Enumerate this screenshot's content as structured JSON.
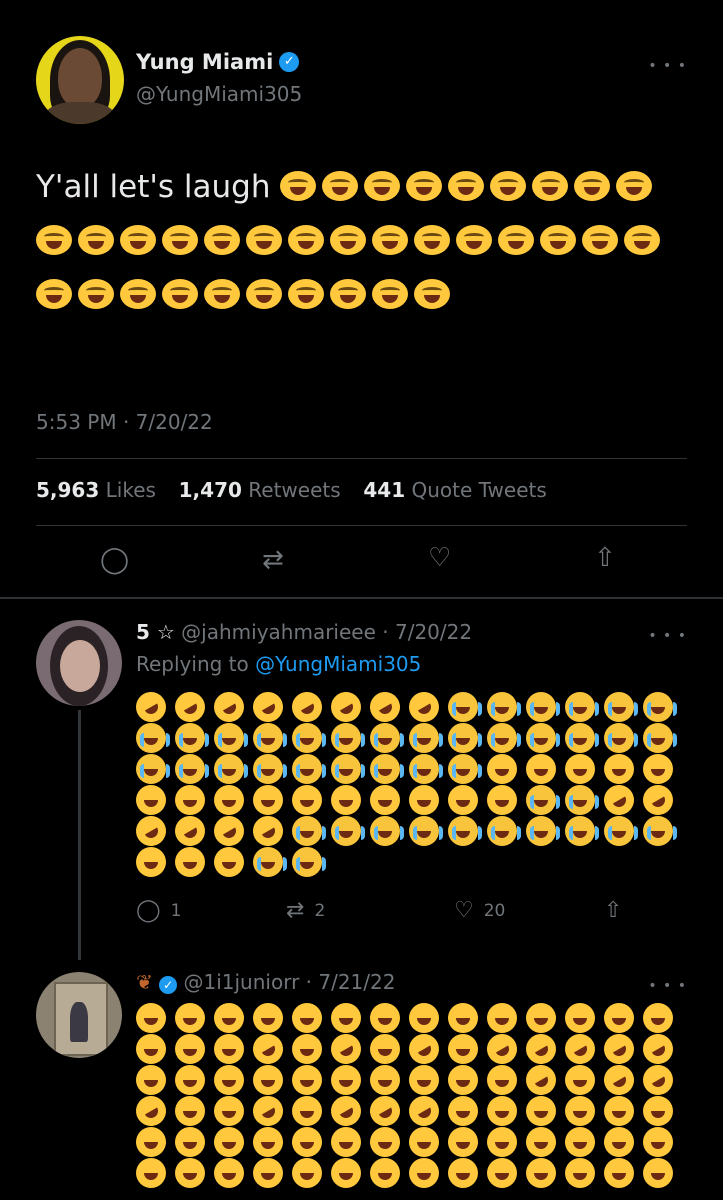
{
  "main_tweet": {
    "name": "Yung Miami",
    "handle": "@YungMiami305",
    "text": "Y'all let's laugh",
    "emoji_count": 34,
    "timestamp": "5:53 PM · 7/20/22",
    "stats": {
      "likes_count": "5,963",
      "likes_label": "Likes",
      "retweets_count": "1,470",
      "retweets_label": "Retweets",
      "quotes_count": "441",
      "quotes_label": "Quote Tweets"
    },
    "icons": [
      "reply-icon",
      "retweet-icon",
      "like-icon",
      "share-icon"
    ]
  },
  "replies": [
    {
      "display": "5 ☆",
      "handle": "@jahmiyahmarieee",
      "date": "· 7/20/22",
      "replying_prefix": "Replying to",
      "replying_to": "@YungMiami305",
      "emojis": [
        "rofl",
        "rofl",
        "rofl",
        "rofl",
        "rofl",
        "rofl",
        "rofl",
        "rofl",
        "sob",
        "sob",
        "sob",
        "sob",
        "sob",
        "sob",
        "sob",
        "sob",
        "sob",
        "sob",
        "sob",
        "sob",
        "sob",
        "sob",
        "sob",
        "sob",
        "sob",
        "sob",
        "sob",
        "sob",
        "sob",
        "sob",
        "sob",
        "sob",
        "sob",
        "sob",
        "sob",
        "sob",
        "sob",
        "joy",
        "joy",
        "joy",
        "joy",
        "joy",
        "joy",
        "joy",
        "joy",
        "joy",
        "joy",
        "joy",
        "joy",
        "joy",
        "joy",
        "joy",
        "sob",
        "sob",
        "rofl",
        "rofl",
        "rofl",
        "rofl",
        "rofl",
        "rofl",
        "sob",
        "sob",
        "sob",
        "sob",
        "sob",
        "sob",
        "sob",
        "sob",
        "sob",
        "sob",
        "joy",
        "joy",
        "joy",
        "sob",
        "sob"
      ],
      "reply_count": "1",
      "retweet_count": "2",
      "like_count": "20"
    },
    {
      "display": "",
      "handle": "@1i1juniorr",
      "date": "· 7/21/22",
      "emojis": [
        "joy",
        "joy",
        "joy",
        "joy",
        "joy",
        "joy",
        "joy",
        "joy",
        "joy",
        "joy",
        "joy",
        "joy",
        "joy",
        "joy",
        "joy",
        "joy",
        "joy",
        "rofl",
        "joy",
        "rofl",
        "joy",
        "rofl",
        "joy",
        "rofl",
        "rofl",
        "rofl",
        "rofl",
        "rofl",
        "joy",
        "joy",
        "joy",
        "joy",
        "joy",
        "joy",
        "joy",
        "joy",
        "joy",
        "joy",
        "rofl",
        "joy",
        "rofl",
        "rofl",
        "rofl",
        "joy",
        "joy",
        "rofl",
        "joy",
        "rofl",
        "rofl",
        "rofl",
        "joy",
        "joy",
        "joy",
        "joy",
        "joy",
        "joy",
        "joy",
        "joy",
        "joy",
        "joy",
        "joy",
        "joy",
        "joy",
        "joy",
        "joy",
        "joy",
        "joy",
        "joy",
        "joy",
        "joy",
        "joy",
        "joy",
        "joy",
        "joy",
        "joy",
        "joy",
        "joy",
        "joy",
        "joy",
        "joy",
        "joy",
        "joy",
        "joy",
        "joy"
      ]
    }
  ]
}
